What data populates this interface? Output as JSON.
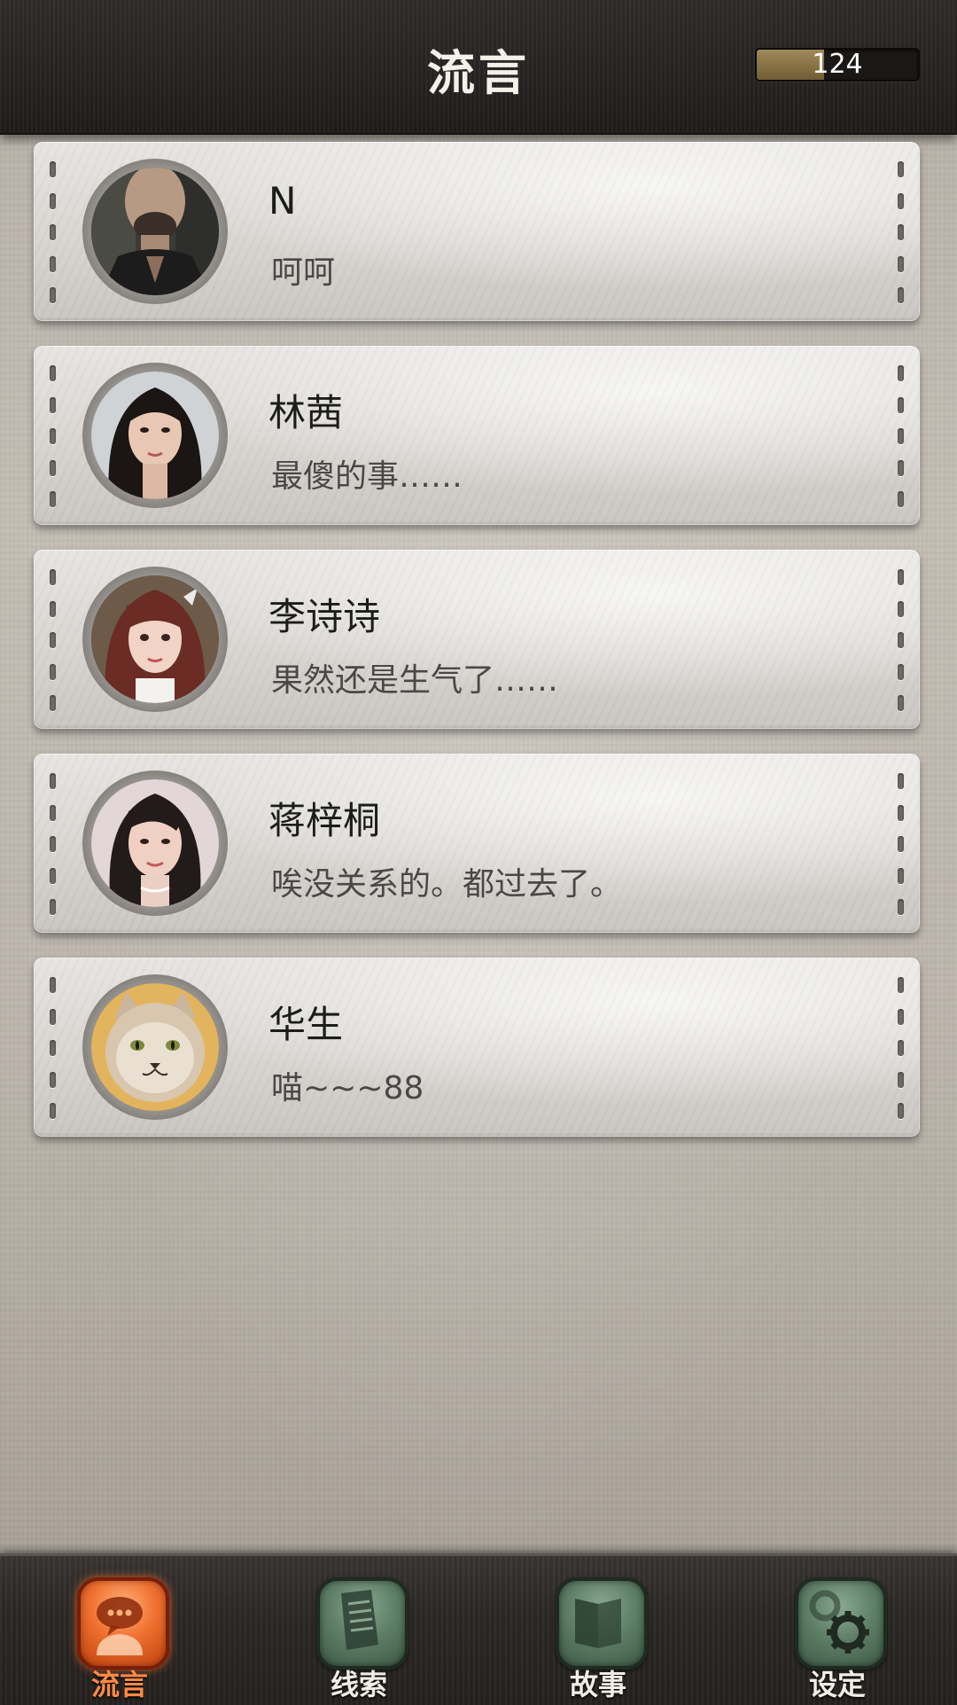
{
  "header": {
    "title": "流言",
    "coin_value": "124",
    "coin_fill": 0.42
  },
  "messages": [
    {
      "name": "N",
      "preview": "呵呵",
      "avatar_icon": "man-avatar"
    },
    {
      "name": "林茜",
      "preview": "最傻的事……",
      "avatar_icon": "woman-avatar"
    },
    {
      "name": "李诗诗",
      "preview": "果然还是生气了……",
      "avatar_icon": "girl-avatar"
    },
    {
      "name": "蒋梓桐",
      "preview": "唉没关系的。都过去了。",
      "avatar_icon": "woman-avatar"
    },
    {
      "name": "华生",
      "preview": "喵~~~88",
      "avatar_icon": "cat-avatar"
    }
  ],
  "tabs": [
    {
      "label": "流言",
      "icon": "chat-bubble-icon",
      "active": true
    },
    {
      "label": "线索",
      "icon": "document-icon",
      "active": false
    },
    {
      "label": "故事",
      "icon": "book-icon",
      "active": false
    },
    {
      "label": "设定",
      "icon": "gear-icon",
      "active": false
    }
  ],
  "colors": {
    "active_tab": "#f07030",
    "inactive_tab": "#5f7f67",
    "topbar": "#262422"
  }
}
